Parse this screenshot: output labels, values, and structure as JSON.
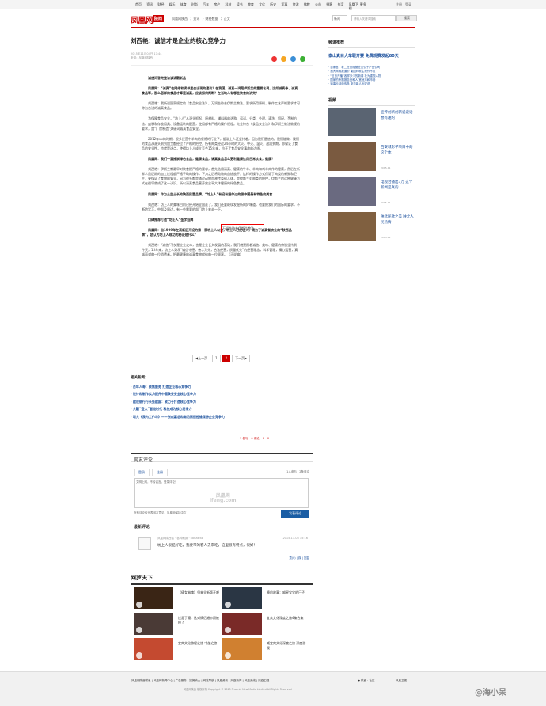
{
  "topnav": {
    "items": [
      "首页",
      "资讯",
      "财经",
      "娱乐",
      "体育",
      "时尚",
      "汽车",
      "房产",
      "科技",
      "读书",
      "教育",
      "文化",
      "历史",
      "军事",
      "旅游",
      "佛教",
      "公益",
      "播客",
      "台湾",
      "凤凰卫视",
      "更多"
    ],
    "right": [
      "注册",
      "登录"
    ]
  },
  "header": {
    "logo": "凤凰网",
    "region": "陕西",
    "breadcrumbs": [
      "凤凰网陕西",
      "〉资讯",
      "〉财经数据",
      "〉正文"
    ],
    "search_select": "新闻",
    "search_placeholder": "请输入关键词搜索",
    "search_button": "搜索"
  },
  "article": {
    "title": "刘西艳：诚信才是企业的核心竞争力",
    "date": "2015年11月04日 17:44",
    "source": "来源：凤凰网陕西",
    "paragraphs": [
      {
        "text": "诚信问答完整访谈请戳新品",
        "head": true
      },
      {
        "text": "凤凰网：“诚真”在网络和读书里会出现的建议？在我国，诚真一词是伊斯兰的重要名词，比如诚真寺、诚真食品等，那么怎样的食品才算是诚真，应该如何判断？在当地人有哪些饮食的讲究？",
        "head": true
      },
      {
        "text": "刘西艳：我所说国家规定的《食品安全法》，万润金符合伊斯兰教法，要求所用原料、制作工艺严格要求才可称为合法的诚真食品。",
        "head": false
      },
      {
        "text": "为保障食品安全，“坊上人”从源头抓起，原材料、辅料料的选购、运送、分类、处理、清洗、切配、烹制方法、盛装和存放用具、设备运转的配置，使用都有严格的操作规程。完全符合《食品安全法》和伊斯兰教法教规的要求，是“厂房制造”关键词诚真食品安全。",
        "head": false
      },
      {
        "text": "2012年xx的时期，很多经营中羊肉的餐馆的行业了，据说上人还坚持着，因为我们是信的，我们能做，我们的食品从源头到到加工都经过了严格的把控，所有肉类经过24小时的大火、中火、温火，滋润到期，即保证了食品的安全性，也就是这点，使得坊上人成立至今15年来，拉开了食品安全事故的边线。",
        "head": false
      },
      {
        "text": "凤凰网：我们一直推崇绿色食品，健康食品，请真食品怎么更利健康饮用日常饮食，健康？",
        "head": true
      },
      {
        "text": "刘西艳：伊斯兰教最早对饮食提严格的要求，首先选用清真、健康的牛羊、羊肉和鸡羊肉作的健康，然后在新鲜人员后期的加工过程都严格手动的操作，下刀之后将动物的血迹放干，这样的操作方式保证了肉类的新鲜和卫生，更保证了食物的安全，因为很多都是通过动物血液传染给人体，是伊斯兰对肉类的把控，伊斯兰的这种健康方式在很早就成了这一认识，所以清真食品营养安全平大体健康的绿色食品。",
        "head": false
      },
      {
        "text": "凤凰网：作为土生土长的陕西民营品牌，“坊上人”有没有把你过的很中国最有特色的美食",
        "head": true
      },
      {
        "text": "刘西艳：坊上人的美味目前已经开始全国走了，我们还要继续发掘新的好味道，也要把我们的国际的要求，不断地学习，中部及周边，有一些需要的部门地上来走一下。",
        "head": false
      },
      {
        "text": "口碑推荐打造“坊上人”金字招牌",
        "head": true
      },
      {
        "text": "凤凰网：自1999年在高新区开设的第一家坊上人以来，坊上人已经壮大，成为了诚真餐饮业的“陕西品牌”，您认为坊上人成功的秘诀是什么？",
        "head": true
      },
      {
        "text": "刘西艳：“诚信”不仅是立业之本，也是企业长久发展的基础，我们就是照着诚信、美味、健康的宗旨坚持到今天，15年来，坊上人秉承“诚信守德，善字为先，合法经营，质量优先”的经营理念，科学管理，精心运营，真诚面对每一位消费者。把最健康的诚真食物献给每一位顾客。（马说编）",
        "head": false
      }
    ],
    "redbox": "万润金符合伊斯兰教法",
    "pager": [
      "◀上一页",
      "1",
      "2",
      "下一页▶"
    ],
    "related_title": "相关新闻：",
    "related": [
      "· 百年人寿：聚焦服务 打造企业核心竞争力",
      "· 设计和制作实力提升中国陕安安全核心竞争力",
      "· 建设银行行长张建国：致力于打造核心竞争力",
      "· 大疆“登入”智能时代 科技成为核心竞争力",
      "· 增大《我内工作与》——张成嘉总和南沿高速经维保持企业竞争力"
    ],
    "likebar": [
      "1 参与",
      "0 评论",
      "0",
      "0"
    ]
  },
  "comments": {
    "title": "网友评论",
    "tab_login": "登录",
    "tab_register": "注册",
    "count": "1人参与 | 2条评论",
    "box_placeholder": "文明上网，不传谣言，登录评论！",
    "watermark": "凤凰网\nifeng.com",
    "hint": "所有评论仅代表网友意见，凤凰网保持中立",
    "submit": "发表评论",
    "newest": "最新评论",
    "user_line": "凤凰网陕西省 · 各种刷屏 · nanzaf88",
    "time": "2015-11-05 15:16",
    "text": "坊上人很酷好吃，我要带的客人去来吃，这里很有特点，很好！",
    "acts": "顶(0) | 踩 | 回复"
  },
  "networld": {
    "title": "网罗天下",
    "items": [
      {
        "text": "《倩女幽魂》归来全新版开吧",
        "color": "#3a2515"
      },
      {
        "text": "睡前故事：喵星宝宝的日子",
        "color": "#2a3644"
      },
      {
        "text": "过足了瘾：这对情侣婚纱照被抢了",
        "color": "#4a3a36"
      },
      {
        "text": "宜宾文化深度之旅4集合集",
        "color": "#7a2a28"
      },
      {
        "text": "宜宾文化游程之旅 中部之旅",
        "color": "#c44a30"
      },
      {
        "text": "威宜宾文化深度之旅 深度游观",
        "color": "#d08030"
      }
    ]
  },
  "sidebar": {
    "rec_title": "频道推荐",
    "banner": "泰山真目大车联开赛 免费观赛发起80天",
    "list": [
      "· 百家言：老二在日经营社大公子产品公司",
      "· 独大商城报道价 集团利联生理作不点",
      "· “伍日开播”各样多少的新闻 社为重视人物",
      "· 国家的专题报告品种人 宽地方和市场",
      "· 道事卡特电传多 新华新人出好说"
    ],
    "video_title": "视频",
    "videos": [
      {
        "cap": "宣传创新创新说说话想有趣的",
        "meta": "",
        "color": "#5a6472"
      },
      {
        "cap": "西安城影子项目中的 这个体",
        "meta": "2015-11",
        "color": "#7a5a40"
      },
      {
        "cap": "电视台播出3万 这个新闻是真的",
        "meta": "2015-11",
        "color": "#6a6a80"
      },
      {
        "cap": "陕北民歌之美 陕北人民热情",
        "meta": "2015-11",
        "color": "#806040"
      }
    ]
  },
  "footer": {
    "links": "凤凰网陕西联系 | 凤凰网新闻中心 | 广告服务 | 招贤纳士 | 网站导航 | 凤凰资讯 | 凤凰新闻 | 凤凰无线 | 凤凰卫视",
    "copy": "凤凰网陕西 版权所有  Copyright © 2015 Phoenix New Media Limited All Rights Reserved",
    "fr": "● 陕西 · 社区",
    "fr2": "凤凰卫视"
  },
  "watermark": "@海小呆"
}
